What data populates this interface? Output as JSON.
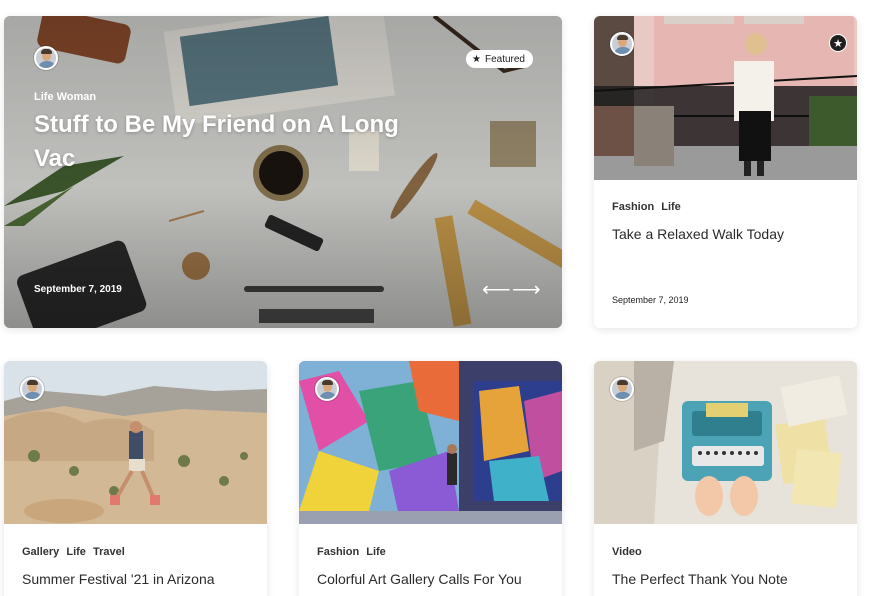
{
  "hero": {
    "category": "Life Woman",
    "title": "Stuff to Be My Friend on A Long Vac",
    "date": "September 7, 2019",
    "featured_label": "Featured",
    "prev_arrow": "⟵",
    "next_arrow": "⟶"
  },
  "cards": [
    {
      "categories": "Fashion  Life",
      "title": "Take a Relaxed Walk Today",
      "date": "September 7, 2019"
    },
    {
      "categories": "Gallery  Life  Travel",
      "title": "Summer Festival '21 in Arizona"
    },
    {
      "categories": "Fashion  Life",
      "title": "Colorful Art Gallery Calls For You"
    },
    {
      "categories": "Video",
      "title": "The Perfect Thank You Note"
    }
  ],
  "icons": {
    "featured": "star-icon",
    "bookmark": "star-icon"
  },
  "colors": {
    "badge_bg": "#ffffff",
    "text_dark": "#2b2b2b",
    "star_btn": "#1f1f1f"
  }
}
